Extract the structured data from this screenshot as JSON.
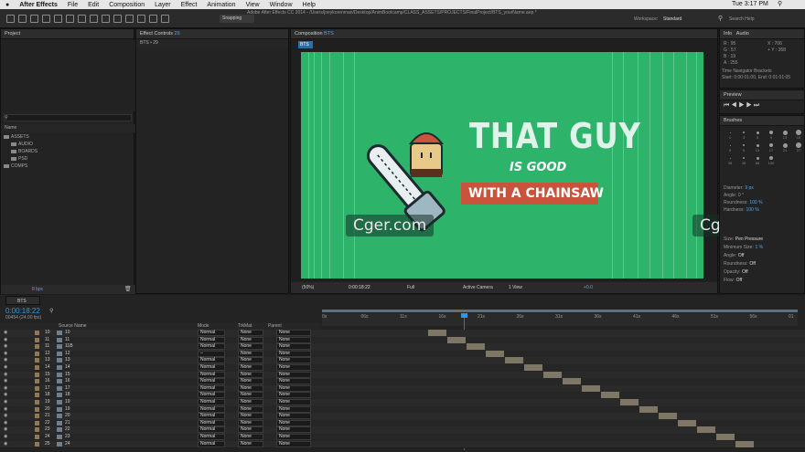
{
  "menubar": {
    "app": "After Effects",
    "items": [
      "File",
      "Edit",
      "Composition",
      "Layer",
      "Effect",
      "Animation",
      "View",
      "Window",
      "Help"
    ],
    "time": "Tue 3:17 PM"
  },
  "titlebar": {
    "title": "Adobe After Effects CC 2014 - /Users/joeykorenman/Desktop/AnimBootcamp/CLASS_ASSETS/PROJECTS/FinalProject/BTS_yourName.aep *"
  },
  "toolbar": {
    "snapping": "Snapping",
    "workspace_label": "Workspace:",
    "workspace_value": "Standard",
    "search_placeholder": "Search Help"
  },
  "project": {
    "tab": "Project",
    "name_header": "Name",
    "items": [
      "ASSETS",
      "AUDIO",
      "BOARDS",
      "PSD",
      "COMPS"
    ],
    "bpc": "8 bpc"
  },
  "effect_controls": {
    "tab": "Effect Controls",
    "tab_target": "26",
    "sub": "BTS • 29"
  },
  "composition": {
    "tab": "Composition",
    "tab_target": "BTS",
    "sub_tab": "BTS",
    "zoom": "(50%)",
    "timecode": "0:00:18:22",
    "resolution": "Full",
    "camera": "Active Camera",
    "views": "1 View",
    "exposure": "+0.0"
  },
  "artwork": {
    "line1": "THAT GUY",
    "line2": "IS GOOD",
    "line3": "WITH A CHAINSAW"
  },
  "watermark": {
    "text": "Cger.com"
  },
  "info": {
    "tab": "Info",
    "tab2": "Audio",
    "r": "R : 95",
    "g": "G : 57",
    "b": "B : 19",
    "a": "A : 255",
    "x": "X : 706",
    "y": "+ Y : 358",
    "tnb": "Time Navigator Brackets",
    "tnb_range": "Start: 0:00:01:00, End: 0:01:01:05"
  },
  "preview": {
    "tab": "Preview"
  },
  "brushes": {
    "tab": "Brushes",
    "sizes": [
      "1",
      "3",
      "5",
      "9",
      "13",
      "19",
      "5",
      "9",
      "13",
      "17",
      "21",
      "27",
      "35",
      "45",
      "65",
      "100"
    ],
    "props": [
      {
        "label": "Diameter:",
        "value": "9 px"
      },
      {
        "label": "Angle:",
        "value": "0 °"
      },
      {
        "label": "Roundness:",
        "value": "100 %"
      },
      {
        "label": "Hardness:",
        "value": "100 %"
      }
    ],
    "dynamics": [
      {
        "label": "Size:",
        "value": "Pen Pressure"
      },
      {
        "label": "Minimum Size:",
        "value": "1 %"
      },
      {
        "label": "Angle:",
        "value": "Off"
      },
      {
        "label": "Roundness:",
        "value": "Off"
      },
      {
        "label": "Opacity:",
        "value": "Off"
      },
      {
        "label": "Flow:",
        "value": "Off"
      }
    ]
  },
  "timeline": {
    "tab": "BTS",
    "timecode": "0:00:18:22",
    "frames": "00454 (24.00 fps)",
    "source_header": "Source Name",
    "mode_header": "Mode",
    "trkmat_header": "TrkMat",
    "parent_header": "Parent",
    "ruler": [
      "0s",
      "06s",
      "11s",
      "16s",
      "21s",
      "26s",
      "31s",
      "36s",
      "41s",
      "46s",
      "51s",
      "56s",
      "01"
    ],
    "layers": [
      {
        "num": "10",
        "name": "10",
        "mode": "Normal",
        "trk": "None",
        "parent": "None"
      },
      {
        "num": "11",
        "name": "11",
        "mode": "Normal",
        "trk": "None",
        "parent": "None"
      },
      {
        "num": "11",
        "name": "11B",
        "mode": "Normal",
        "trk": "None",
        "parent": "None"
      },
      {
        "num": "12",
        "name": "12",
        "mode": "–",
        "trk": "None",
        "parent": "None"
      },
      {
        "num": "13",
        "name": "13",
        "mode": "Normal",
        "trk": "None",
        "parent": "None"
      },
      {
        "num": "14",
        "name": "14",
        "mode": "Normal",
        "trk": "None",
        "parent": "None"
      },
      {
        "num": "15",
        "name": "15",
        "mode": "Normal",
        "trk": "None",
        "parent": "None"
      },
      {
        "num": "16",
        "name": "16",
        "mode": "Normal",
        "trk": "None",
        "parent": "None"
      },
      {
        "num": "17",
        "name": "17",
        "mode": "Normal",
        "trk": "None",
        "parent": "None"
      },
      {
        "num": "18",
        "name": "18",
        "mode": "Normal",
        "trk": "None",
        "parent": "None"
      },
      {
        "num": "19",
        "name": "19",
        "mode": "Normal",
        "trk": "None",
        "parent": "None"
      },
      {
        "num": "20",
        "name": "19",
        "mode": "Normal",
        "trk": "None",
        "parent": "None"
      },
      {
        "num": "21",
        "name": "20",
        "mode": "Normal",
        "trk": "None",
        "parent": "None"
      },
      {
        "num": "22",
        "name": "21",
        "mode": "Normal",
        "trk": "None",
        "parent": "None"
      },
      {
        "num": "23",
        "name": "22",
        "mode": "Normal",
        "trk": "None",
        "parent": "None"
      },
      {
        "num": "24",
        "name": "23",
        "mode": "Normal",
        "trk": "None",
        "parent": "None"
      },
      {
        "num": "25",
        "name": "24",
        "mode": "Normal",
        "trk": "None",
        "parent": "None"
      }
    ]
  },
  "colors": {
    "comp_green": "#2eb36a",
    "accent_blue": "#2b9be0",
    "bar": "#7f7765",
    "banner": "#c9533b"
  }
}
